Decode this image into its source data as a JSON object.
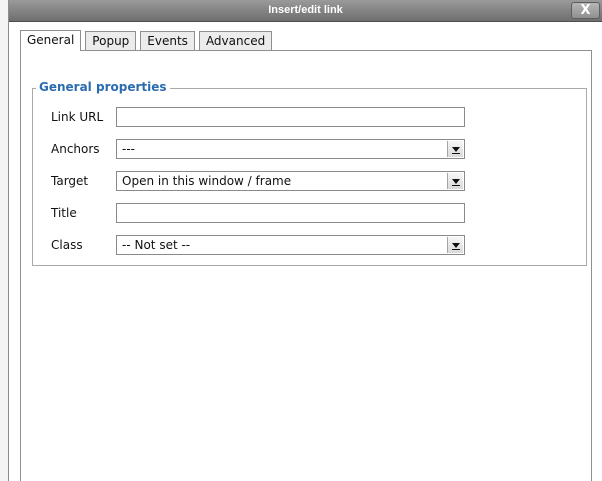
{
  "window": {
    "title": "Insert/edit link",
    "close_label": "X"
  },
  "tabs": [
    {
      "label": "General",
      "active": true
    },
    {
      "label": "Popup",
      "active": false
    },
    {
      "label": "Events",
      "active": false
    },
    {
      "label": "Advanced",
      "active": false
    }
  ],
  "general_properties": {
    "legend": "General properties",
    "link_url": {
      "label": "Link URL",
      "value": ""
    },
    "anchors": {
      "label": "Anchors",
      "value": "---"
    },
    "target": {
      "label": "Target",
      "value": "Open in this window / frame"
    },
    "title": {
      "label": "Title",
      "value": ""
    },
    "class": {
      "label": "Class",
      "value": "-- Not set --"
    }
  },
  "colors": {
    "legend_blue": "#2b6cb0",
    "titlebar_gray": "#7f7f7f"
  }
}
